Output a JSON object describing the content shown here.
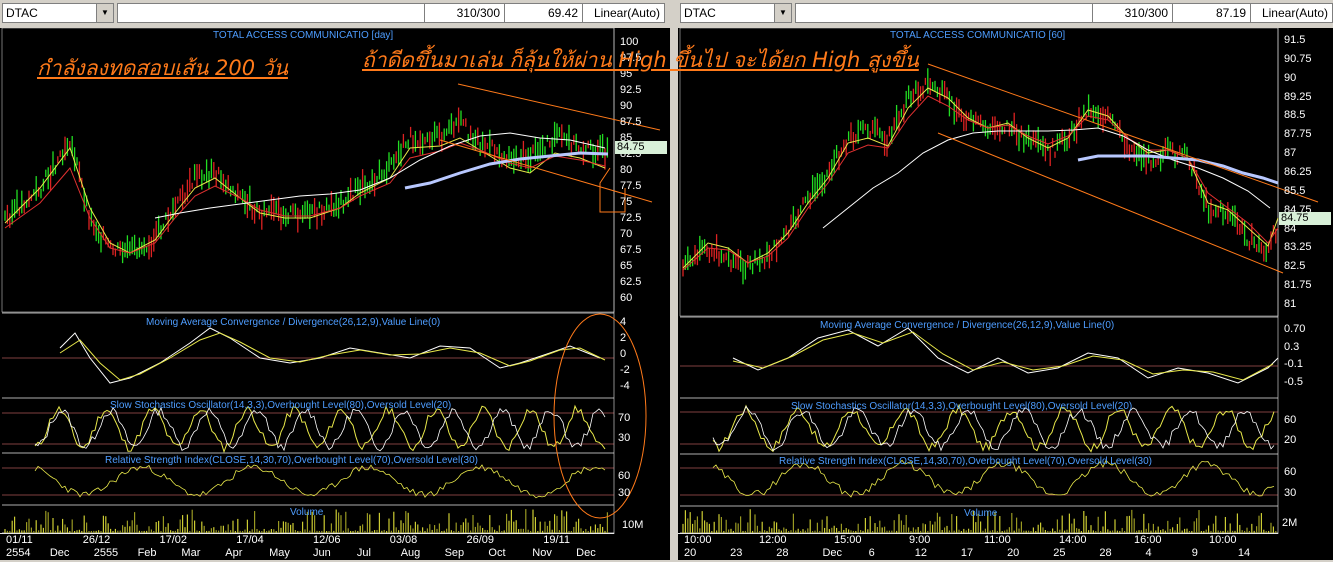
{
  "left": {
    "symbol": "DTAC",
    "bars": "310/300",
    "price": "69.42",
    "scale": "Linear(Auto)",
    "title": "TOTAL ACCESS COMMUNICATIO [day]",
    "annotation": "กำลังลงทดสอบเส้น 200 วัน",
    "last_price": "84.75",
    "price_ticks": [
      "100",
      "97.5",
      "95",
      "92.5",
      "90",
      "87.5",
      "85",
      "82.5",
      "80",
      "77.5",
      "75",
      "72.5",
      "70",
      "67.5",
      "65",
      "62.5",
      "60"
    ],
    "macd_title": "Moving Average Convergence / Divergence(26,12,9),Value Line(0)",
    "macd_ticks": [
      "4",
      "2",
      "0",
      "-2",
      "-4"
    ],
    "stoch_title": "Slow Stochastics Oscillator(14,3,3),Overbought Level(80),Oversold Level(20)",
    "stoch_ticks": [
      "70",
      "30"
    ],
    "rsi_title": "Relative Strength Index(CLOSE,14,30,70),Overbought Level(70),Oversold Level(30)",
    "rsi_ticks": [
      "60",
      "30"
    ],
    "volume_title": "Volume",
    "volume_tick": "10M",
    "x_top": [
      "01/11",
      "26/12",
      "17/02",
      "17/04",
      "12/06",
      "03/08",
      "26/09",
      "19/11"
    ],
    "x_bottom": [
      "2554",
      "Dec",
      "2555",
      "Feb",
      "Mar",
      "Apr",
      "May",
      "Jun",
      "Jul",
      "Aug",
      "Sep",
      "Oct",
      "Nov",
      "Dec"
    ]
  },
  "right": {
    "symbol": "DTAC",
    "bars": "310/300",
    "price": "87.19",
    "scale": "Linear(Auto)",
    "title": "TOTAL ACCESS COMMUNICATIO [60]",
    "annotation": "ถ้าดีดขึ้นมาเล่น ก็ลุ้นให้ผ่าน High ขึ้นไป จะได้ยก High สูงขึ้น",
    "last_price": "84.75",
    "price_ticks": [
      "91.5",
      "90.75",
      "90",
      "89.25",
      "88.5",
      "87.75",
      "87",
      "86.25",
      "85.5",
      "84.75",
      "84",
      "83.25",
      "82.5",
      "81.75",
      "81"
    ],
    "macd_title": "Moving Average Convergence / Divergence(26,12,9),Value Line(0)",
    "macd_ticks": [
      "0.70",
      "0.3",
      "-0.1",
      "-0.5"
    ],
    "stoch_title": "Slow Stochastics Oscillator(14,3,3),Overbought Level(80),Oversold Level(20)",
    "stoch_ticks": [
      "60",
      "20"
    ],
    "rsi_title": "Relative Strength Index(CLOSE,14,30,70),Overbought Level(70),Oversold Level(30)",
    "rsi_ticks": [
      "60",
      "30"
    ],
    "volume_title": "Volume",
    "volume_tick": "2M",
    "x_top": [
      "10:00",
      "12:00",
      "15:00",
      "9:00",
      "11:00",
      "14:00",
      "16:00",
      "10:00"
    ],
    "x_bottom": [
      "20",
      "23",
      "28",
      "Dec",
      "6",
      "12",
      "17",
      "20",
      "25",
      "28",
      "4",
      "9",
      "14"
    ]
  }
}
